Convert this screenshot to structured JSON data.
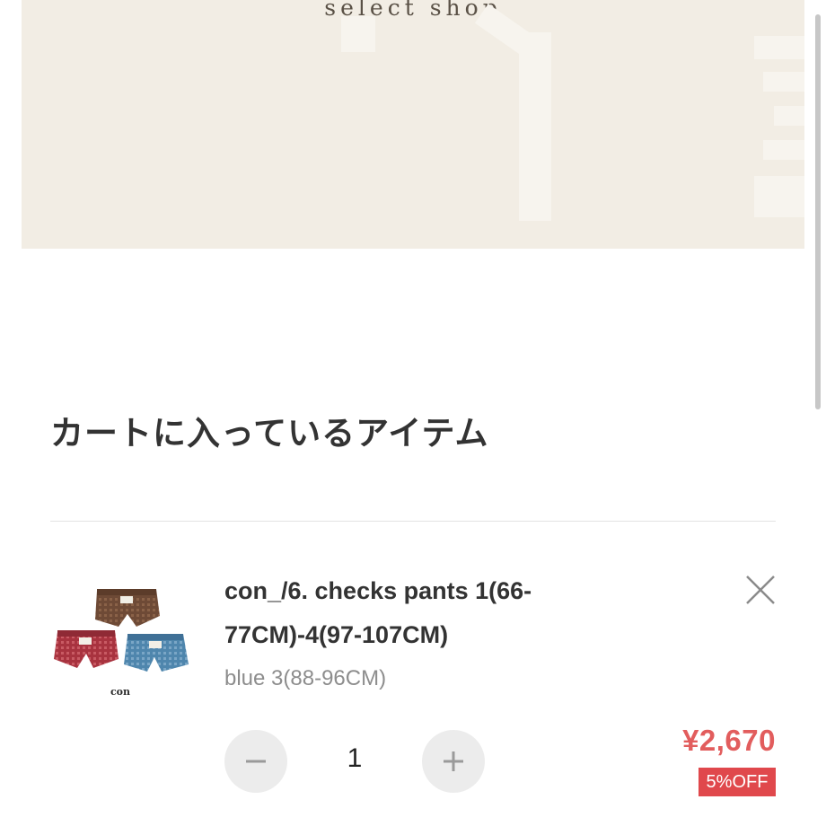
{
  "banner": {
    "tagline": "select shop"
  },
  "cart": {
    "section_title": "カートに入っているアイテム",
    "items": [
      {
        "name": "con_/6. checks pants 1(66-77CM)-4(97-107CM)",
        "variant": "blue 3(88-96CM)",
        "thumbnail_label": "con",
        "quantity": "1",
        "price": "¥2,670",
        "discount": "5%OFF",
        "remove_icon": "close-icon",
        "decrement_icon": "minus-icon",
        "increment_icon": "plus-icon"
      }
    ]
  },
  "colors": {
    "banner_bg": "#f2ede4",
    "price": "#e25d5d",
    "discount_bg": "#e0484c",
    "text": "#333333",
    "muted": "#8d8d8d"
  }
}
